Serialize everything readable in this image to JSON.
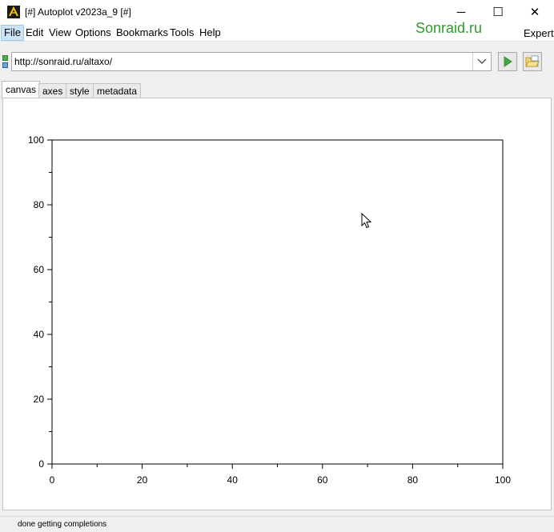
{
  "window": {
    "title": "[#] Autoplot v2023a_9 [#]",
    "minimize_glyph": "─",
    "maximize_glyph": "☐",
    "close_glyph": "✕"
  },
  "menu": {
    "items": [
      "File",
      "Edit",
      "View",
      "Options",
      "Bookmarks",
      "Tools",
      "Help"
    ],
    "expert_label": "Expert"
  },
  "brand": {
    "text": "Sonraid.ru",
    "color": "#2e9b2e"
  },
  "url_bar": {
    "value": "http://sonraid.ru/altaxo/"
  },
  "tabs": [
    "canvas",
    "axes",
    "style",
    "metadata"
  ],
  "active_tab": "canvas",
  "status": {
    "text": "done getting completions"
  },
  "icons": {
    "app": "autoplot-app-icon",
    "dropdown": "chevron-down-icon",
    "go": "play-icon",
    "open": "folder-open-icon"
  },
  "chart_data": {
    "type": "scatter",
    "title": "",
    "xlabel": "",
    "ylabel": "",
    "xlim": [
      0,
      100
    ],
    "ylim": [
      0,
      100
    ],
    "xticks": [
      0,
      20,
      40,
      60,
      80,
      100
    ],
    "yticks": [
      0,
      20,
      40,
      60,
      80,
      100
    ],
    "xtick_labels": [
      "0",
      "20",
      "40",
      "60",
      "80",
      "100"
    ],
    "ytick_labels": [
      "0",
      "20",
      "40",
      "60",
      "80",
      "100"
    ],
    "series": [],
    "grid": false
  }
}
